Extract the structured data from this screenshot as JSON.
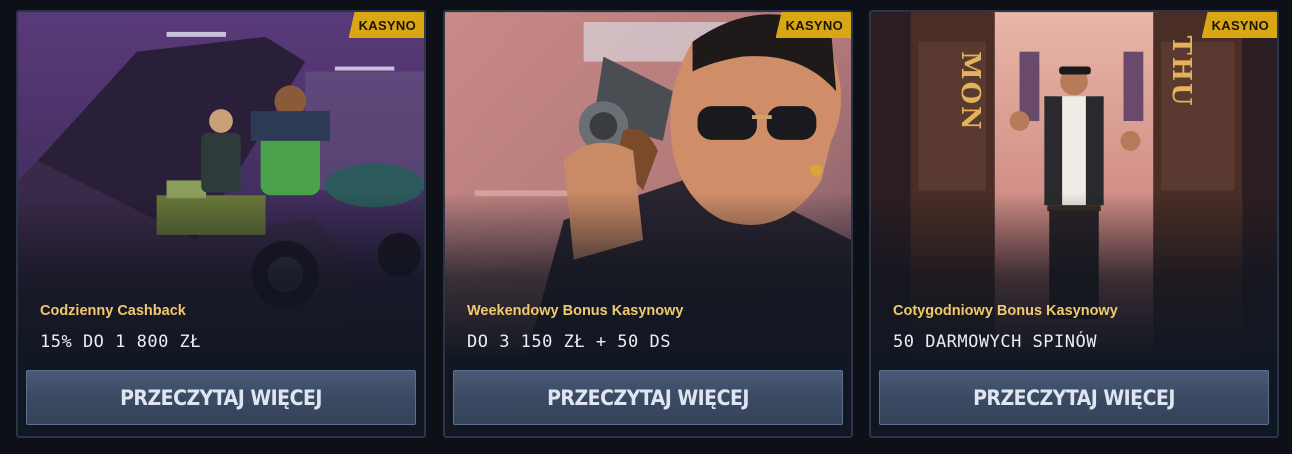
{
  "cards": [
    {
      "badge": "KASYNO",
      "title": "Codzienny Cashback",
      "offer": "15% DO 1 800 ZŁ",
      "button_label": "PRZECZYTAJ WIĘCEJ",
      "artwork": "garage-cash-trunk-illustration"
    },
    {
      "badge": "KASYNO",
      "title": "Weekendowy Bonus Kasynowy",
      "offer": "DO 3 150 ZŁ + 50 DS",
      "button_label": "PRZECZYTAJ WIĘCEJ",
      "artwork": "mobster-revolver-illustration"
    },
    {
      "badge": "KASYNO",
      "title": "Cotygodniowy Bonus Kasynowy",
      "offer": "50 DARMOWYCH SPINÓW",
      "button_label": "PRZECZYTAJ WIĘCEJ",
      "artwork": "casino-doors-mon-thu-illustration",
      "door_left_text": "MON",
      "door_right_text": "THU"
    }
  ],
  "colors": {
    "badge": "#d8a713",
    "title": "#f2c96b",
    "button": "#3b4a63",
    "background": "#0d1016"
  }
}
